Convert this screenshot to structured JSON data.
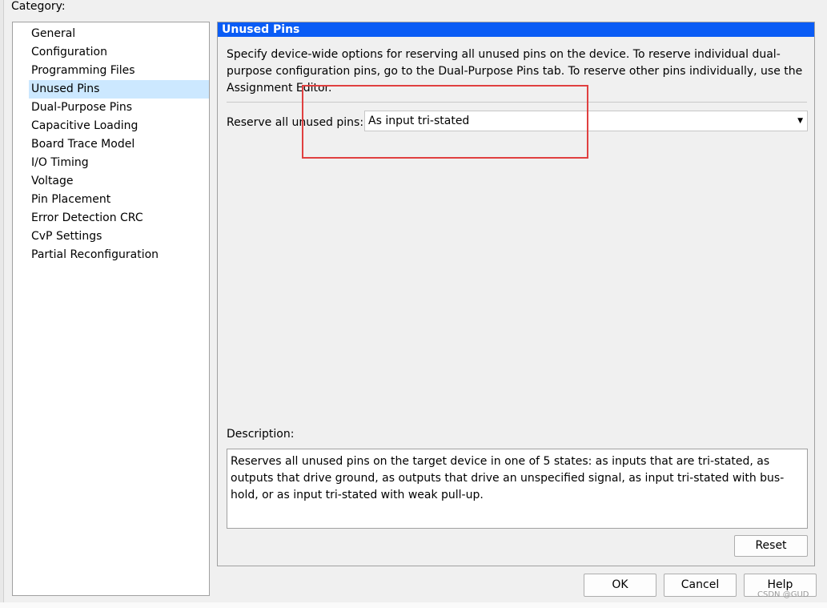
{
  "category_label": "Category:",
  "categories": [
    {
      "label": "General"
    },
    {
      "label": "Configuration"
    },
    {
      "label": "Programming Files"
    },
    {
      "label": "Unused Pins",
      "selected": true
    },
    {
      "label": "Dual-Purpose Pins"
    },
    {
      "label": "Capacitive Loading"
    },
    {
      "label": "Board Trace Model"
    },
    {
      "label": "I/O Timing"
    },
    {
      "label": "Voltage"
    },
    {
      "label": "Pin Placement"
    },
    {
      "label": "Error Detection CRC"
    },
    {
      "label": "CvP Settings"
    },
    {
      "label": "Partial Reconfiguration"
    }
  ],
  "panel": {
    "title": "Unused Pins",
    "intro": "Specify device-wide options for reserving all unused pins on the device. To reserve individual dual-purpose configuration pins, go to the Dual-Purpose Pins tab. To reserve other pins individually, use the Assignment Editor.",
    "reserve_label": "Reserve all unused pins:",
    "reserve_value": "As input tri-stated",
    "description_label": "Description:",
    "description_text": "Reserves all unused pins on the target device in one of 5 states: as inputs that are tri-stated, as outputs that drive ground, as outputs that drive an unspecified signal, as input tri-stated with bus-hold, or as input tri-stated with weak pull-up.",
    "reset_label": "Reset"
  },
  "buttons": {
    "ok": "OK",
    "cancel": "Cancel",
    "help": "Help"
  },
  "watermark": "CSDN @GUD",
  "colors": {
    "header_bg": "#0a5cf5",
    "selected_bg": "#cce8ff",
    "highlight": "#e04040"
  },
  "icons": {
    "dropdown": "chevron-down-icon"
  }
}
